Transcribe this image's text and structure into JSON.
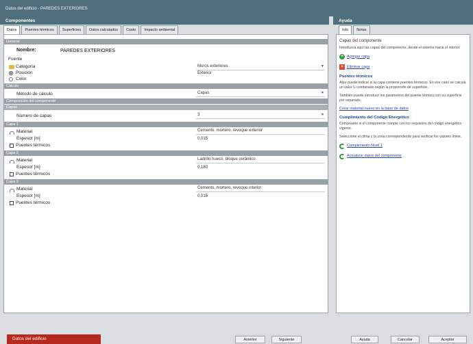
{
  "window": {
    "title": "Datos del edificio - PAREDES EXTERIORES"
  },
  "left_panel": {
    "header": "Componentes",
    "tabs": [
      "Datos",
      "Puentes térmicos",
      "Superficies",
      "Datos calculados",
      "Costo",
      "Impacto ambiental"
    ],
    "active_tab": 0,
    "sections": {
      "general": "General",
      "calc": "Cálculo",
      "layers_group": "Composición del componente",
      "layers": "Capas",
      "layer1": "Capa 1",
      "layer2": "Capa 2",
      "layer3": "Capa 3"
    },
    "name_label": "Nombre:",
    "name_value": "PAREDES EXTERIORES",
    "source_label": "Fuente",
    "category_label": "Categoría",
    "category_value": "Muros exteriores",
    "position_label": "Posición",
    "position_value": "Exterior",
    "colour_label": "Color",
    "calc_method_label": "Método de cálculo",
    "calc_method_value": "Capas",
    "layer_count_label": "Número de capas",
    "layer_count_value": "3",
    "layers": [
      {
        "material_label": "Material",
        "material_value": "Cemento, mortero, revoque exterior",
        "thickness_label": "Espesor [m]",
        "thickness_value": "0,015",
        "bridge_label": "Puentes térmicos"
      },
      {
        "material_label": "Material",
        "material_value": "Ladrillo hueco, bloque cerámico",
        "thickness_label": "Espesor [m]",
        "thickness_value": "0,180",
        "bridge_label": "Puentes térmicos"
      },
      {
        "material_label": "Material",
        "material_value": "Cemento, mortero, revoque interior",
        "thickness_label": "Espesor [m]",
        "thickness_value": "0,015",
        "bridge_label": "Puentes térmicos"
      }
    ]
  },
  "right_panel": {
    "header": "Ayuda",
    "tabs": [
      "Info",
      "Notas"
    ],
    "title": "Capas del componente",
    "intro": "Introduzca aquí las capas del componente, desde el exterior hacia el interior.",
    "add_layer": "Agregar capa",
    "delete_layer": "Eliminar capa",
    "thermal_bridges_heading": "Puentes térmicos",
    "thermal_bridges_text": "Aquí puede indicar si la capa contiene puentes térmicos. En ese caso se calcula un valor U combinado según la proporción de superficie.",
    "thermal_bridges_text2": "También puede introducir los parámetros del puente térmico con su superficie por separado.",
    "create_material_link": "Crear material nuevo en la base de datos",
    "energy_code_heading": "Cumplimiento del Código Energético",
    "energy_code_text": "Compruebe si el componente cumple con los requisitos del código energético vigente.",
    "energy_code_text2": "Seleccione el clima y la zona correspondiente para verificar los valores límite.",
    "energy_code_link": "Cumplimiento Nivel 1",
    "update_link": "Actualizar datos del componente"
  },
  "footer": {
    "data_button": "Datos del edificio",
    "buttons": [
      "Anterior",
      "Siguiente",
      "Ayuda",
      "Cancelar",
      "Aceptar"
    ]
  },
  "colors": {
    "titlebar": "#4f6f7d",
    "accent_red": "#b52a1c",
    "section_bar": "#97a1a6"
  }
}
